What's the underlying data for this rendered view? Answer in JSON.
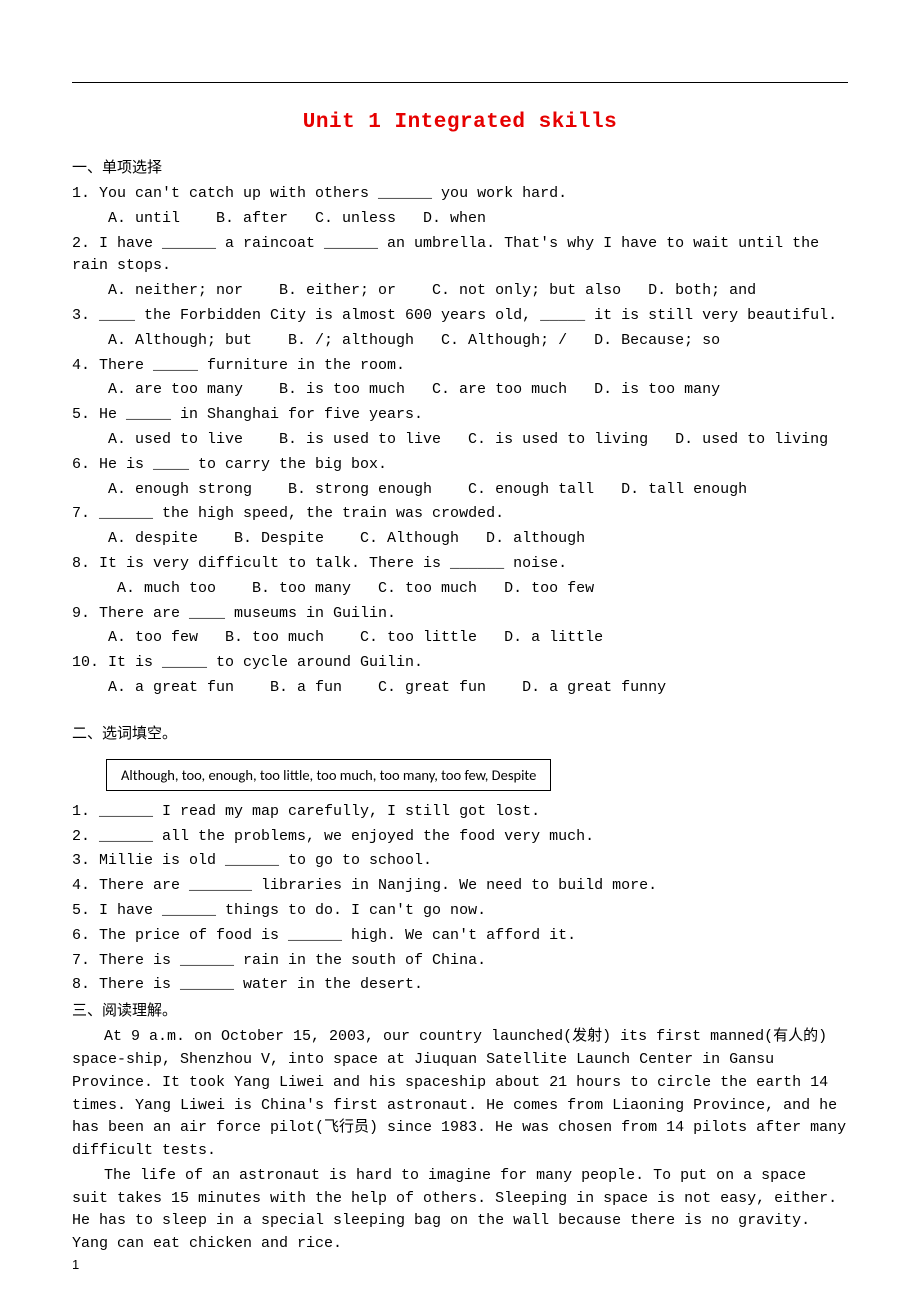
{
  "title": "Unit 1 Integrated skills",
  "section1": {
    "heading": "一、单项选择",
    "items": [
      {
        "q": "1. You can't catch up with others ______ you work hard.",
        "opts": "A. until    B. after   C. unless   D. when"
      },
      {
        "q": "2. I have ______ a raincoat ______ an umbrella. That's why I have to wait until the rain stops.",
        "opts": "A. neither; nor    B. either; or    C. not only; but also   D. both; and"
      },
      {
        "q": "3. ____ the Forbidden City is almost 600 years old, _____ it is still very beautiful.",
        "opts": "A. Although; but    B. /; although   C. Although; /   D. Because; so"
      },
      {
        "q": "4. There _____ furniture in the room.",
        "opts": "A. are too many    B. is too much   C. are too much   D. is too many"
      },
      {
        "q": "5. He _____ in Shanghai for five years.",
        "opts": "A. used to live    B. is used to live   C. is used to living   D. used to living"
      },
      {
        "q": "6. He is ____ to carry the big box.",
        "opts": "A. enough strong    B. strong enough    C. enough tall   D. tall enough"
      },
      {
        "q": "7. ______ the high speed, the train was crowded.",
        "opts": "A. despite    B. Despite    C. Although   D. although"
      },
      {
        "q": "8. It is very difficult to talk. There is ______ noise.",
        "opts": " A. much too    B. too many   C. too much   D. too few"
      },
      {
        "q": "9. There are ____ museums in Guilin.",
        "opts": "A. too few   B. too much    C. too little   D. a little"
      },
      {
        "q": "10. It is _____ to cycle around Guilin.",
        "opts": "A. a great fun    B. a fun    C. great fun    D. a great funny"
      }
    ]
  },
  "section2": {
    "heading": "二、选词填空。",
    "wordbank": "Although, too, enough, too little, too much, too many, too few, Despite",
    "items": [
      "1. ______ I read my map carefully, I still got lost.",
      "2. ______ all the problems, we enjoyed the food very much.",
      "3. Millie is old ______ to go to school.",
      "4. There are _______ libraries in Nanjing. We need to build more.",
      "5. I have ______ things to do. I can't go now.",
      "6. The price of food is ______ high. We can't afford it.",
      "7. There is ______ rain in the south of China.",
      "8. There is ______ water in the desert."
    ]
  },
  "section3": {
    "heading": " 三、阅读理解。",
    "paragraphs": [
      "At 9 a.m. on October 15, 2003, our country launched(发射) its first manned(有人的) space-ship, Shenzhou V, into space at Jiuquan Satellite Launch Center in Gansu Province. It took Yang Liwei and his spaceship about 21 hours to circle the earth 14 times. Yang Liwei is China's first astronaut. He comes from Liaoning Province, and he has been an air force pilot(飞行员) since 1983. He was chosen from 14 pilots after many difficult tests.",
      "The life of an astronaut is hard to imagine for many people. To put on a space suit takes 15 minutes with the help of others. Sleeping in space is not easy, either. He has to sleep in a special sleeping bag on the wall because there is no gravity. Yang can eat chicken and rice."
    ]
  },
  "page_number": "1"
}
